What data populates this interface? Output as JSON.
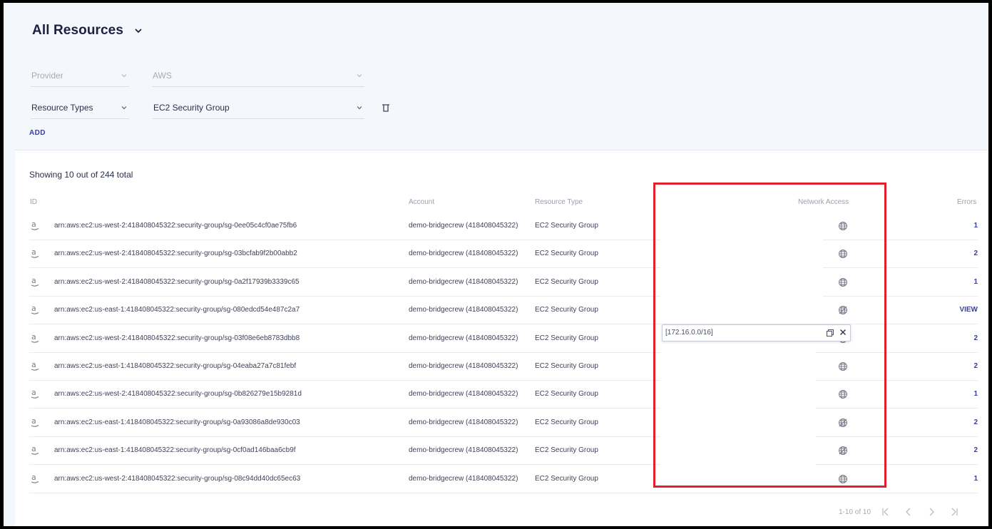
{
  "header": {
    "title": "All Resources"
  },
  "filters": {
    "provider_label": "Provider",
    "provider_value": "AWS",
    "resource_types_label": "Resource Types",
    "resource_types_value": "EC2 Security Group",
    "add_label": "ADD"
  },
  "table": {
    "showing": "Showing 10 out of 244 total",
    "columns": {
      "id": "ID",
      "account": "Account",
      "resource_type": "Resource Type",
      "network_access": "Network Access",
      "errors": "Errors"
    },
    "rows": [
      {
        "id": "arn:aws:ec2:us-west-2:418408045322:security-group/sg-0ee05c4cf0ae75fb6",
        "account": "demo-bridgecrew (418408045322)",
        "type": "EC2 Security Group",
        "network": "public",
        "errors": "1"
      },
      {
        "id": "arn:aws:ec2:us-west-2:418408045322:security-group/sg-03bcfab9f2b00abb2",
        "account": "demo-bridgecrew (418408045322)",
        "type": "EC2 Security Group",
        "network": "public",
        "errors": "2"
      },
      {
        "id": "arn:aws:ec2:us-west-2:418408045322:security-group/sg-0a2f17939b3339c65",
        "account": "demo-bridgecrew (418408045322)",
        "type": "EC2 Security Group",
        "network": "public",
        "errors": "1"
      },
      {
        "id": "arn:aws:ec2:us-east-1:418408045322:security-group/sg-080edcd54e487c2a7",
        "account": "demo-bridgecrew (418408045322)",
        "type": "EC2 Security Group",
        "network": "private",
        "errors": "VIEW"
      },
      {
        "id": "arn:aws:ec2:us-west-2:418408045322:security-group/sg-03f08e6eb8783dbb8",
        "account": "demo-bridgecrew (418408045322)",
        "type": "EC2 Security Group",
        "network": "public",
        "errors": "2"
      },
      {
        "id": "arn:aws:ec2:us-east-1:418408045322:security-group/sg-04eaba27a7c81febf",
        "account": "demo-bridgecrew (418408045322)",
        "type": "EC2 Security Group",
        "network": "public",
        "errors": "2"
      },
      {
        "id": "arn:aws:ec2:us-west-2:418408045322:security-group/sg-0b826279e15b9281d",
        "account": "demo-bridgecrew (418408045322)",
        "type": "EC2 Security Group",
        "network": "public",
        "errors": "1"
      },
      {
        "id": "arn:aws:ec2:us-east-1:418408045322:security-group/sg-0a93086a8de930c03",
        "account": "demo-bridgecrew (418408045322)",
        "type": "EC2 Security Group",
        "network": "private",
        "errors": "2"
      },
      {
        "id": "arn:aws:ec2:us-east-1:418408045322:security-group/sg-0cf0ad146baa6cb9f",
        "account": "demo-bridgecrew (418408045322)",
        "type": "EC2 Security Group",
        "network": "private",
        "errors": "2"
      },
      {
        "id": "arn:aws:ec2:us-west-2:418408045322:security-group/sg-08c94dd40dc65ec63",
        "account": "demo-bridgecrew (418408045322)",
        "type": "EC2 Security Group",
        "network": "public",
        "errors": "1"
      }
    ]
  },
  "popover": {
    "text": "[172.16.0.0/16]"
  },
  "pagination": {
    "text": "1-10 of 10"
  },
  "colors": {
    "accent": "#3a3f9a",
    "highlight": "#e0202a",
    "background": "#f4f7fc"
  },
  "icons": {
    "aws": "aws-logo-icon",
    "public": "globe-icon",
    "private": "globe-crossed-icon"
  }
}
